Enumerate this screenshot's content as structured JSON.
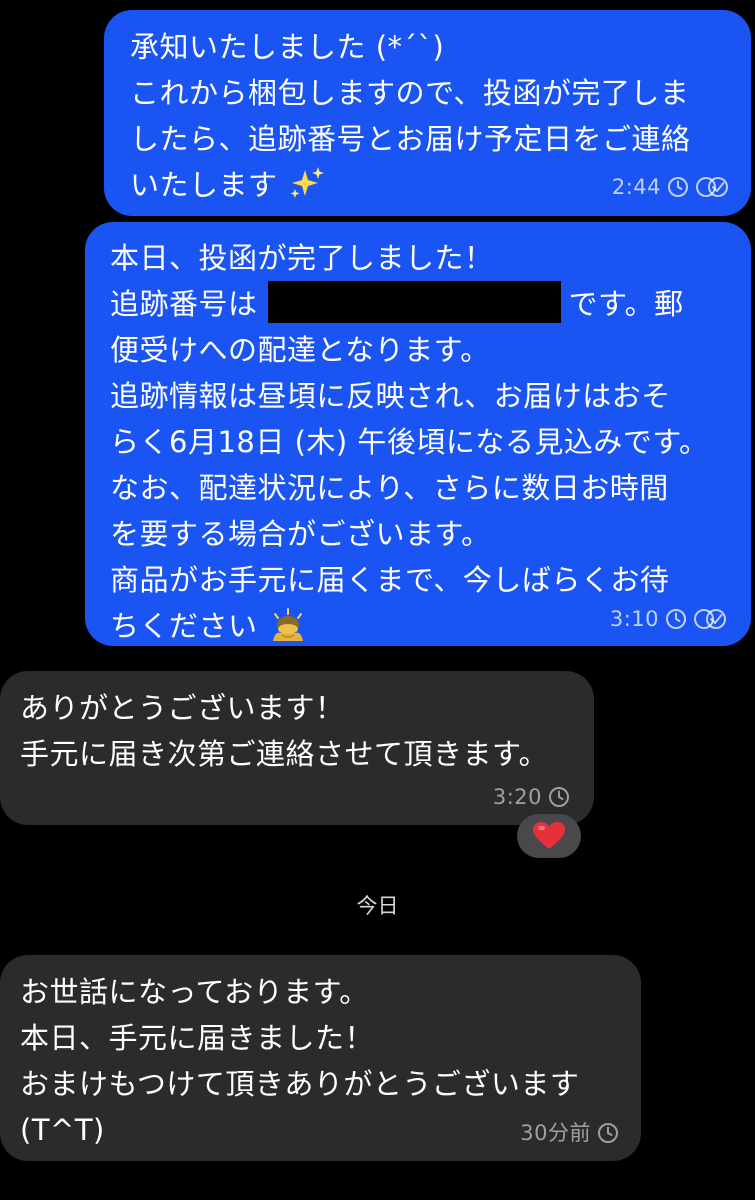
{
  "colors": {
    "background": "#000000",
    "outgoing_bubble": "#1a55f3",
    "incoming_bubble": "#2b2b2d",
    "reaction_pill": "#49494b",
    "text": "#ffffff"
  },
  "messages": [
    {
      "direction": "outgoing",
      "lines": [
        "承知いたしました (*´`)",
        "これから梱包しますので、投函が完了しま",
        "したら、追跡番号とお届け予定日をご連絡",
        "いたします"
      ],
      "emoji": "sparkles-icon",
      "time": "2:44",
      "status_icons": [
        "clock-icon",
        "double-check-icon"
      ]
    },
    {
      "direction": "outgoing",
      "lines": [
        "本日、投函が完了しました！",
        "追跡番号は",
        "です。郵",
        "便受けへの配達となります。",
        "追跡情報は昼頃に反映され、お届けはおそ",
        "らく6月18日 (木) 午後頃になる見込みです。",
        "なお、配達状況により、さらに数日お時間",
        "を要する場合がございます。",
        "商品がお手元に届くまで、今しばらくお待",
        "ちください"
      ],
      "redacted_tracking_number": true,
      "emoji": "person-bowing-icon",
      "time": "3:10",
      "status_icons": [
        "clock-icon",
        "double-check-icon"
      ]
    },
    {
      "direction": "incoming",
      "lines": [
        "ありがとうございます！",
        "手元に届き次第ご連絡させて頂きます。"
      ],
      "time": "3:20",
      "status_icons": [
        "clock-icon"
      ],
      "reaction": "heart-icon"
    },
    {
      "direction": "incoming",
      "lines": [
        "お世話になっております。",
        "本日、手元に届きました！",
        "おまけもつけて頂きありがとうございます",
        "(T^T)"
      ],
      "time": "30分前",
      "status_icons": [
        "clock-icon"
      ]
    }
  ],
  "day_separator": "今日"
}
